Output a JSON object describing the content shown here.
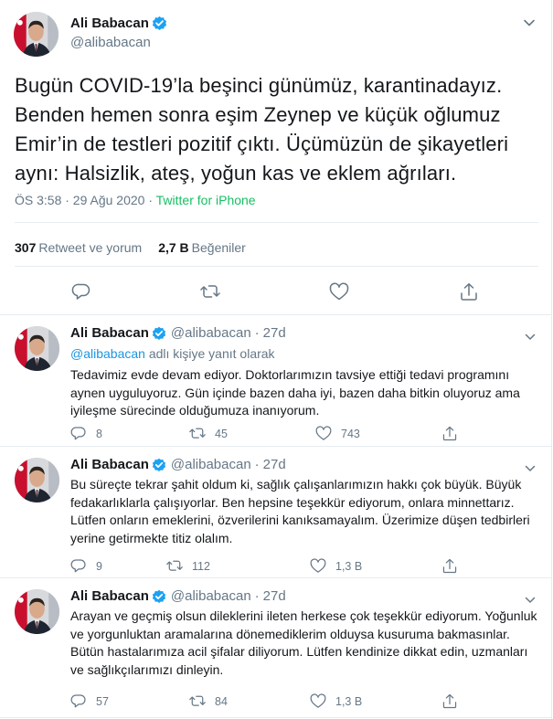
{
  "main_tweet": {
    "author_name": "Ali Babacan",
    "handle": "@alibabacan",
    "text": "Bugün COVID-19’la beşinci günümüz, karantinadayız. Benden hemen sonra eşim Zeynep ve küçük oğlumuz Emir’in de testleri pozitif çıktı. Üçümüzün de şikayetleri aynı: Halsizlik, ateş, yoğun kas ve eklem ağrıları.",
    "timestamp": "ÖS 3:58 · 29 Ağu 2020",
    "separator": " · ",
    "source": "Twitter for iPhone",
    "retweet_count": "307",
    "retweet_label": "Retweet ve yorum",
    "like_count": "2,7 B",
    "like_label": "Beğeniler"
  },
  "replies": [
    {
      "author_name": "Ali Babacan",
      "handle": "@alibabacan",
      "time": "27d",
      "reply_to_handle": "@alibabacan",
      "reply_to_suffix": " adlı kişiye yanıt olarak",
      "text": "Tedavimiz evde devam ediyor. Doktorlarımızın tavsiye ettiği tedavi programını aynen uyguluyoruz. Gün içinde bazen daha iyi, bazen daha bitkin oluyoruz ama iyileşme sürecinde olduğumuza inanıyorum.",
      "replies": "8",
      "retweets": "45",
      "likes": "743"
    },
    {
      "author_name": "Ali Babacan",
      "handle": "@alibabacan",
      "time": "27d",
      "text": "Bu süreçte tekrar şahit oldum ki, sağlık çalışanlarımızın hakkı çok büyük. Büyük fedakarlıklarla çalışıyorlar. Ben hepsine teşekkür ediyorum, onlara minnettarız. Lütfen onların emeklerini, özverilerini kanıksamayalım. Üzerimize düşen tedbirleri yerine getirmekte titiz olalım.",
      "replies": "9",
      "retweets": "112",
      "likes": "1,3 B"
    },
    {
      "author_name": "Ali Babacan",
      "handle": "@alibabacan",
      "time": "27d",
      "text": "Arayan ve geçmiş olsun dileklerini ileten herkese çok teşekkür ediyorum. Yoğunluk ve yorgunluktan aramalarına dönemediklerim olduysa kusuruma bakmasınlar. Bütün hastalarımıza acil şifalar diliyorum. Lütfen kendinize dikkat edin, uzmanları ve sağlıkçılarımızı dinleyin.",
      "replies": "57",
      "retweets": "84",
      "likes": "1,3 B"
    }
  ],
  "colors": {
    "text": "#14171a",
    "muted": "#657786",
    "link": "#1b95e0",
    "source_green": "#17bf63",
    "verified": "#1da1f2",
    "divider": "#e6ecf0"
  },
  "icons": [
    "verified-badge-icon",
    "chevron-down-icon",
    "reply-icon",
    "retweet-icon",
    "like-icon",
    "share-icon"
  ]
}
